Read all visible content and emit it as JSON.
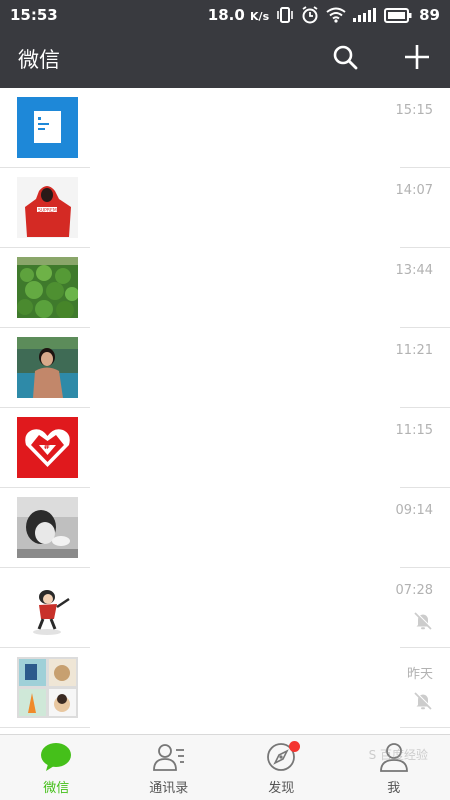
{
  "status_bar": {
    "time": "15:53",
    "network_speed": "18.0",
    "speed_unit": "K/s",
    "battery": "89",
    "icons": [
      "vibrate-icon",
      "alarm-icon",
      "wifi-icon",
      "signal-icon",
      "battery-icon"
    ]
  },
  "header": {
    "title": "微信",
    "actions": [
      "search-icon",
      "plus-icon"
    ]
  },
  "chats": [
    {
      "avatar": "document-avatar",
      "time": "15:15",
      "muted": false
    },
    {
      "avatar": "red-hoodie-avatar",
      "time": "14:07",
      "muted": false
    },
    {
      "avatar": "green-leaves-avatar",
      "time": "13:44",
      "muted": false
    },
    {
      "avatar": "woman-portrait-avatar",
      "time": "11:21",
      "muted": false
    },
    {
      "avatar": "pinduoduo-heart-avatar",
      "time": "11:15",
      "muted": false
    },
    {
      "avatar": "grayscale-child-avatar",
      "time": "09:14",
      "muted": false
    },
    {
      "avatar": "cartoon-girl-avatar",
      "time": "07:28",
      "muted": true
    },
    {
      "avatar": "group-collage-avatar",
      "time": "昨天",
      "muted": true
    }
  ],
  "tabs": [
    {
      "label": "微信",
      "icon": "chat-bubble-icon",
      "active": true
    },
    {
      "label": "通讯录",
      "icon": "contacts-icon",
      "active": false
    },
    {
      "label": "发现",
      "icon": "compass-icon",
      "active": false,
      "badge": true
    },
    {
      "label": "我",
      "icon": "person-icon",
      "active": false
    }
  ],
  "watermark": "S 百度经验",
  "colors": {
    "header_bg": "#393a3f",
    "accent_green": "#45c01a",
    "badge_red": "#f43530",
    "time_gray": "#b2b2b2"
  }
}
